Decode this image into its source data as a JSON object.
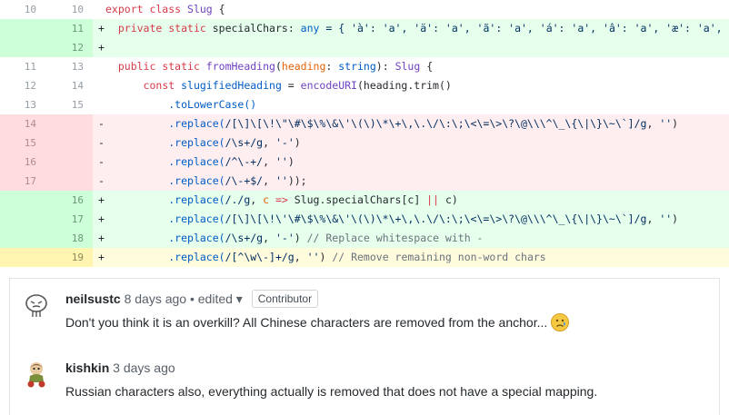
{
  "diff": {
    "rows": [
      {
        "type": "ctx",
        "old": "10",
        "new": "10",
        "mark": ""
      },
      {
        "type": "add",
        "old": "",
        "new": "11",
        "mark": "+"
      },
      {
        "type": "add",
        "old": "",
        "new": "12",
        "mark": "+"
      },
      {
        "type": "ctx",
        "old": "11",
        "new": "13",
        "mark": ""
      },
      {
        "type": "ctx",
        "old": "12",
        "new": "14",
        "mark": ""
      },
      {
        "type": "ctx",
        "old": "13",
        "new": "15",
        "mark": ""
      },
      {
        "type": "del",
        "old": "14",
        "new": "",
        "mark": "-"
      },
      {
        "type": "del",
        "old": "15",
        "new": "",
        "mark": "-"
      },
      {
        "type": "del",
        "old": "16",
        "new": "",
        "mark": "-"
      },
      {
        "type": "del",
        "old": "17",
        "new": "",
        "mark": "-"
      },
      {
        "type": "add",
        "old": "",
        "new": "16",
        "mark": "+"
      },
      {
        "type": "add",
        "old": "",
        "new": "17",
        "mark": "+"
      },
      {
        "type": "add",
        "old": "",
        "new": "18",
        "mark": "+"
      },
      {
        "type": "hl",
        "old": "",
        "new": "19",
        "mark": "+"
      }
    ],
    "code": {
      "l0_kw": "export class ",
      "l0_ty": "Slug",
      "l0_rest": " {",
      "l1_kw": "private static ",
      "l1_name": "specialChars",
      "l1_colon": ": ",
      "l1_any": "any",
      "l1_rest": " = { 'à': 'a', 'ä': 'a', 'ã': 'a', 'á': 'a', 'â': 'a', 'æ': 'a', 'å': 'a', 'ë': 'e'",
      "l3_kw": "public static ",
      "l3_fn": "fromHeading",
      "l3_p1": "(",
      "l3_param": "heading",
      "l3_p2": ": ",
      "l3_type": "string",
      "l3_p3": "): ",
      "l3_ret": "Slug",
      "l3_end": " {",
      "l4_kw": "const ",
      "l4_var": "slugifiedHeading",
      "l4_eq": " = ",
      "l4_fn": "encodeURI",
      "l4_rest": "(heading.trim()",
      "l5": ".toLowerCase()",
      "l6_a": ".replace(",
      "l6_re": "/[\\]\\[\\!\\\"\\#\\$\\%\\&\\'\\(\\)\\*\\+\\,\\.\\/\\:\\;\\<\\=\\>\\?\\@\\\\\\^\\_\\{\\|\\}\\~\\`]/g",
      "l6_b": ", ",
      "l6_s": "''",
      "l6_c": ")",
      "l7_a": ".replace(",
      "l7_re": "/\\s+/g",
      "l7_b": ", ",
      "l7_s": "'-'",
      "l7_c": ")",
      "l8_a": ".replace(",
      "l8_re": "/^\\-+/",
      "l8_b": ", ",
      "l8_s": "''",
      "l8_c": ")",
      "l9_a": ".replace(",
      "l9_re": "/\\-+$/",
      "l9_b": ", ",
      "l9_s": "''",
      "l9_c": "));",
      "l10_a": ".replace(",
      "l10_re": "/./g",
      "l10_b": ", ",
      "l10_c": "c",
      "l10_arrow": " => ",
      "l10_d": "Slug.specialChars[c] ",
      "l10_or": "||",
      "l10_e": " c)",
      "l11_a": ".replace(",
      "l11_re": "/[\\]\\[\\!\\'\\#\\$\\%\\&\\'\\(\\)\\*\\+\\,\\.\\/\\:\\;\\<\\=\\>\\?\\@\\\\\\^\\_\\{\\|\\}\\~\\`]/g",
      "l11_b": ", ",
      "l11_s": "''",
      "l11_c": ")",
      "l12_a": ".replace(",
      "l12_re": "/\\s+/g",
      "l12_b": ", ",
      "l12_s": "'-'",
      "l12_c": ") ",
      "l12_cm": "// Replace whitespace with -",
      "l13_a": ".replace(",
      "l13_re": "/[^\\w\\-]+/g",
      "l13_b": ", ",
      "l13_s": "''",
      "l13_c": ") ",
      "l13_cm": "// Remove remaining non-word chars"
    }
  },
  "comments": [
    {
      "author": "neilsustc",
      "time": "8 days ago",
      "edited": "• edited ▾",
      "badge": "Contributor",
      "body": "Don't you think it is an overkill? All Chinese characters are removed from the anchor...",
      "emoji": "disappointed-face"
    },
    {
      "author": "kishkin",
      "time": "3 days ago",
      "body": "Russian characters also, everything actually is removed that does not have a special mapping."
    }
  ],
  "colors": {
    "add_bg": "#e6ffed",
    "add_gutter": "#cdffd8",
    "del_bg": "#ffeef0",
    "del_gutter": "#ffdce0",
    "highlight_bg": "#fffbdd",
    "keyword": "#d73a49",
    "type": "#6f42c1",
    "string": "#032f62",
    "comment": "#6a737d"
  }
}
